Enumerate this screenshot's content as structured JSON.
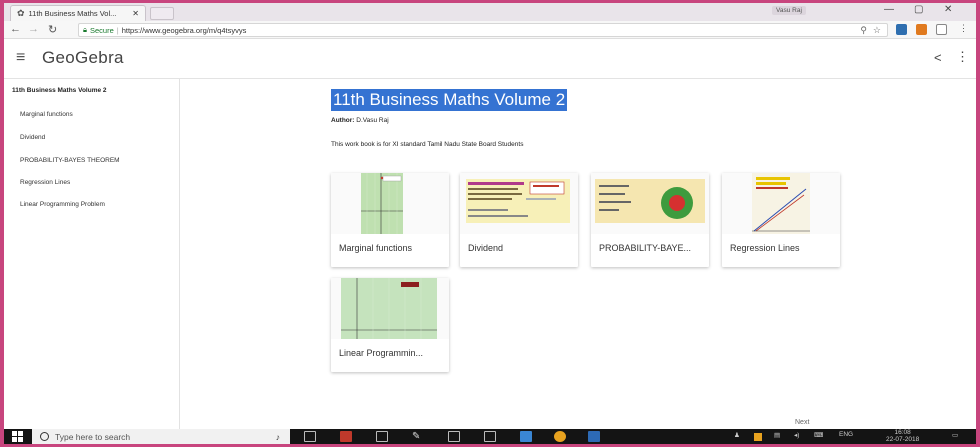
{
  "browser": {
    "tab_title": "11th Business Maths Vol...",
    "tab_close": "✕",
    "user_badge": "Vasu Raj",
    "secure_label": "Secure",
    "url": "https://www.geogebra.org/m/q4tsyvys"
  },
  "header": {
    "logo": "GeoGebra"
  },
  "sidebar": {
    "title": "11th Business Maths Volume 2",
    "items": [
      {
        "label": "Marginal functions"
      },
      {
        "label": "Dividend"
      },
      {
        "label": "PROBABILITY-BAYES THEOREM"
      },
      {
        "label": "Regression Lines"
      },
      {
        "label": "Linear Programming Problem"
      }
    ]
  },
  "main": {
    "title": "11th Business Maths Volume 2",
    "author_prefix": "Author:",
    "author_name": "D.Vasu Raj",
    "description": "This work book is for XI standard Tamil Nadu State Board Students",
    "cards": [
      {
        "label": "Marginal functions"
      },
      {
        "label": "Dividend"
      },
      {
        "label": "PROBABILITY-BAYE..."
      },
      {
        "label": "Regression Lines"
      },
      {
        "label": "Linear Programmin..."
      }
    ],
    "next_label": "Next"
  },
  "taskbar": {
    "search_placeholder": "Type here to search",
    "language": "ENG",
    "time": "16:08",
    "date": "22-07-2018"
  }
}
